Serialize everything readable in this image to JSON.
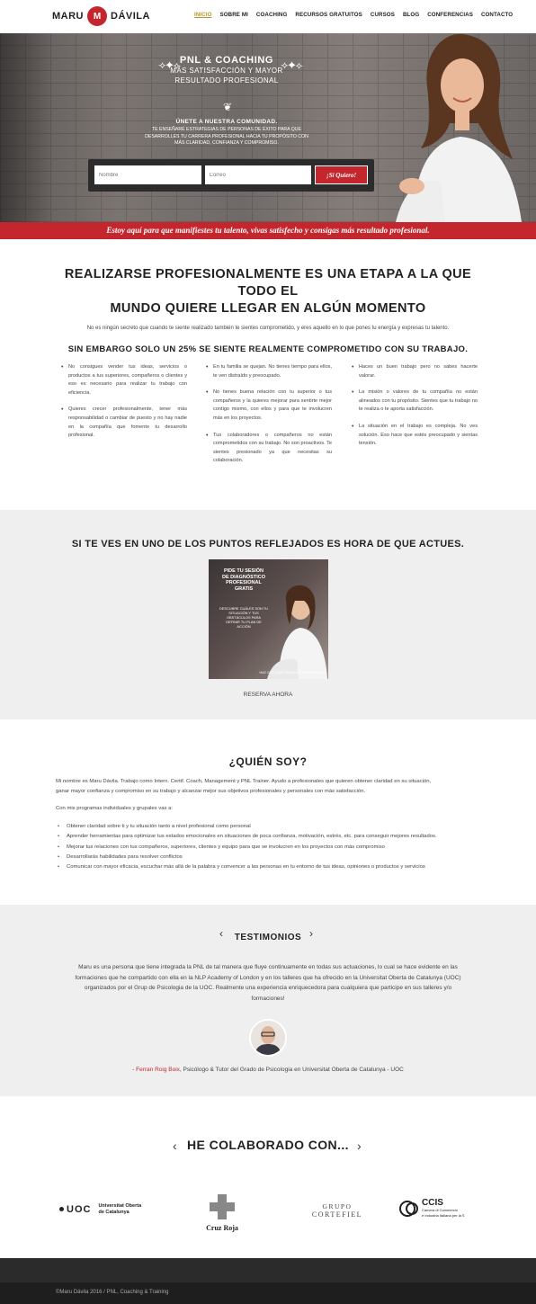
{
  "brand": {
    "name_left": "MARU",
    "mark": "M",
    "name_right": "DÁVILA"
  },
  "nav": [
    {
      "label": "INICIO",
      "active": true
    },
    {
      "label": "SOBRE MI"
    },
    {
      "label": "COACHING"
    },
    {
      "label": "RECURSOS GRATUITOS"
    },
    {
      "label": "CURSOS"
    },
    {
      "label": "BLOG"
    },
    {
      "label": "CONFERENCIAS"
    },
    {
      "label": "CONTACTO"
    }
  ],
  "hero": {
    "title": "PNL & COACHING",
    "subtitle_1": "MÁS SATISFACCIÓN Y MAYOR",
    "subtitle_2": "RESULTADO PROFESIONAL",
    "join_title": "ÚNETE A NUESTRA COMUNIDAD.",
    "join_line_1": "TE ENSEÑARÉ ESTRATEGIAS DE PERSONAS DE ÉXITO PARA QUE",
    "join_line_2": "DESARROLLES TU CARRERA PROFESIONAL HACIA TU PROPÓSITO CON",
    "join_line_3": "MÁS CLARIDAD, CONFIANZA Y COMPROMISO.",
    "name_placeholder": "Nombre",
    "email_placeholder": "Correo",
    "cta": "¡Sí Quiero!",
    "tagline": "Estoy aquí para que manifiestes tu talento, vivas satisfecho y consigas más resultado profesional."
  },
  "section1": {
    "title_1": "REALIZARSE PROFESIONALMENTE ES UNA ETAPA A LA QUE TODO EL",
    "title_2": "MUNDO QUIERE LLEGAR EN ALGÚN MOMENTO",
    "intro": "No es ningún secreto que cuando te siente realizado también te sientes comprometido, y eres aquello en lo que pones tu energía y expresas tu talento.",
    "subtitle": "SIN EMBARGO SOLO UN 25% SE SIENTE REALMENTE COMPROMETIDO CON SU TRABAJO.",
    "col1": [
      "No consigues vender tus ideas, servicios o productos a tus superiores, compañeros o clientes y eso es necesario para realizar tu trabajo con eficiencia.",
      "Quieres crecer profesionalmente, tener más responsabilidad o cambiar de puesto y no hay nadie en la compañía que fomente tu desarrollo profesional."
    ],
    "col2": [
      "En tu familia se quejan. No tienes tiempo para ellos, te ven distraído y preocupado.",
      "No tienes buena relación con tu superior o tus compañeros y la quieres mejorar para sentirte mejor contigo mismo, con ellos y para que te involucren más en los proyectos.",
      "Tus colaboradores o compañeros no están comprometidos con su trabajo. No son proactivos. Te sientes presionado ya que necesitas su colaboración."
    ],
    "col3": [
      "Haces un buen trabajo pero no sabes hacerte valorar.",
      "La misión o valores de tu compañía no están alineados con tu propósito. Sientes que tu trabajo no te realiza o te aporta satisfacción.",
      "La situación en el trabajo es compleja. No ves solución. Eso hace que estés preocupado y sientas tensión."
    ]
  },
  "section2": {
    "title": "SI TE VES EN UNO DE LOS PUNTOS REFLEJADOS ES HORA DE QUE ACTUES.",
    "promo_title_1": "PIDE TU SESIÓN",
    "promo_title_2": "DE DIAGNÓSTICO",
    "promo_title_3": "PROFESIONAL",
    "promo_title_4": "GRATIS",
    "promo_text_1": "DESCUBRE CUÁLES SON TU",
    "promo_text_2": "SITUACIÓN Y TUS",
    "promo_text_3": "OBSTÁCULOS PARA",
    "promo_text_4": "DEFINIR TU PLAN DE",
    "promo_text_5": "ACCIÓN",
    "promo_click": "HAZ CLIC AQUÍ PARA MÁS INFORMACIÓN",
    "reserve": "RESERVA AHORA"
  },
  "section3": {
    "title": "¿QUIÉN SOY?",
    "p1_a": "Mi nombre es Maru Dávila. Trabajo como Intern. Certif. Coach, Management y PNL Trainer. Ayudo a  profesionales que quieren obtener claridad en su situación,",
    "p1_b": "ganar mayor confianza y compromiso en su trabajo y alcanzar mejor sus objetivos profesionales y personales con más satisfacción.",
    "p2": "Con mis programas individuales y grupales vas a:",
    "list": [
      "Obtener claridad sobre ti y tu situación tanto a nivel profesional como personal",
      "Aprender herramientas para optimizar tus estados emocionales en situaciones de poca confianza, motivación, estrés, etc. para conseguir mejores resultados.",
      "Mejorar tus relaciones con tus compañeros, superiores, clientes y equipo para que se involucren en los proyectos con más compromiso",
      "Desarrollarás habilidades para resolver conflictos",
      "Comunicar con mayor eficacia, escuchar más allá de la palabra y convencer a las personas en tu entorno de tus ideas, opiniones o productos y servicios"
    ]
  },
  "section4": {
    "title": "TESTIMONIOS",
    "quote_1": "Maru es una persona que tiene integrada la PNL de tal manera que fluye continuamente en todas sus actuaciones, lo cual se hace evidente en las",
    "quote_2": "formaciones que he compartido con ella en la NLP Academy of London y en los talleres que ha ofrecido en la Universitat Oberta de Catalunya (UOC)",
    "quote_3": "organizados por el Grup de Psicologia de la UOC. Realmente una experiencia enriquecedora para cualquiera que participe en sus talleres y/o",
    "quote_4": "formaciones!",
    "author_name": "- Ferran Roig Boix",
    "author_role": ", Psicólogo & Tutor del Grado de Psicologia en Universitat Oberta de Catalunya - UOC"
  },
  "section5": {
    "title": "HE COLABORADO CON...",
    "uoc_1": "Universitat Oberta",
    "uoc_2": "de Catalunya",
    "uoc_mark": "UOC",
    "cruzroja": "Cruz Roja",
    "cortefiel_1": "GRUPO",
    "cortefiel_2": "CORTEFIEL",
    "ccis": "CCIS",
    "ccis_sub_1": "Camera di Commercio",
    "ccis_sub_2": "e Industria Italiana per la S"
  },
  "footer": {
    "text": "©Maru Dávila 2016 / PNL, Coaching & Training"
  },
  "colors": {
    "accent": "#c4262e",
    "active_nav": "#b5962a",
    "gray_bg": "#efefef"
  }
}
